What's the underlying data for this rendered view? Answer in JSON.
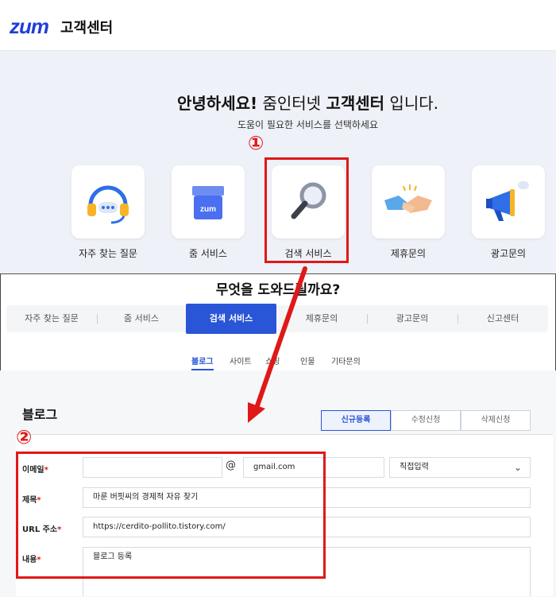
{
  "header": {
    "logo": "zum",
    "title": "고객센터"
  },
  "hero": {
    "greeting_bold": "안녕하세요!",
    "greeting_mid": "줌인터넷",
    "greeting_bold2": "고객센터",
    "greeting_end": "입니다.",
    "subtitle": "도움이 필요한 서비스를 선택하세요",
    "cards": [
      {
        "label": "자주 찾는 질문",
        "icon": "headset-icon"
      },
      {
        "label": "줌 서비스",
        "icon": "store-icon",
        "badge": "zum"
      },
      {
        "label": "검색 서비스",
        "icon": "magnifier-icon"
      },
      {
        "label": "제휴문의",
        "icon": "handshake-icon"
      },
      {
        "label": "광고문의",
        "icon": "megaphone-icon"
      }
    ]
  },
  "annotations": {
    "marker1": "①",
    "marker2": "②"
  },
  "question": "무엇을 도와드릴까요?",
  "tabs": [
    "자주 찾는 질문",
    "줌 서비스",
    "검색 서비스",
    "제휴문의",
    "광고문의",
    "신고센터"
  ],
  "subtabs": [
    "블로그",
    "사이트",
    "쇼핑",
    "인물",
    "기타문의"
  ],
  "form": {
    "section_title": "블로그",
    "segments": [
      "신규등록",
      "수정신청",
      "삭제신청"
    ],
    "labels": {
      "email": "이메일",
      "subject": "제목",
      "url": "URL 주소",
      "content": "내용"
    },
    "required_mark": "*",
    "email_user": "",
    "at": "@",
    "email_domain": "gmail.com",
    "domain_select": "직접입력",
    "subject_value": "마룬 버핏씨의 경제적 자유 찾기",
    "url_value": "https://cerdito-pollito.tistory.com/",
    "content_value": "블로그 등록"
  },
  "colors": {
    "accent": "#2a55d6",
    "brand": "#1f3fd8",
    "annotation": "#e01818"
  }
}
